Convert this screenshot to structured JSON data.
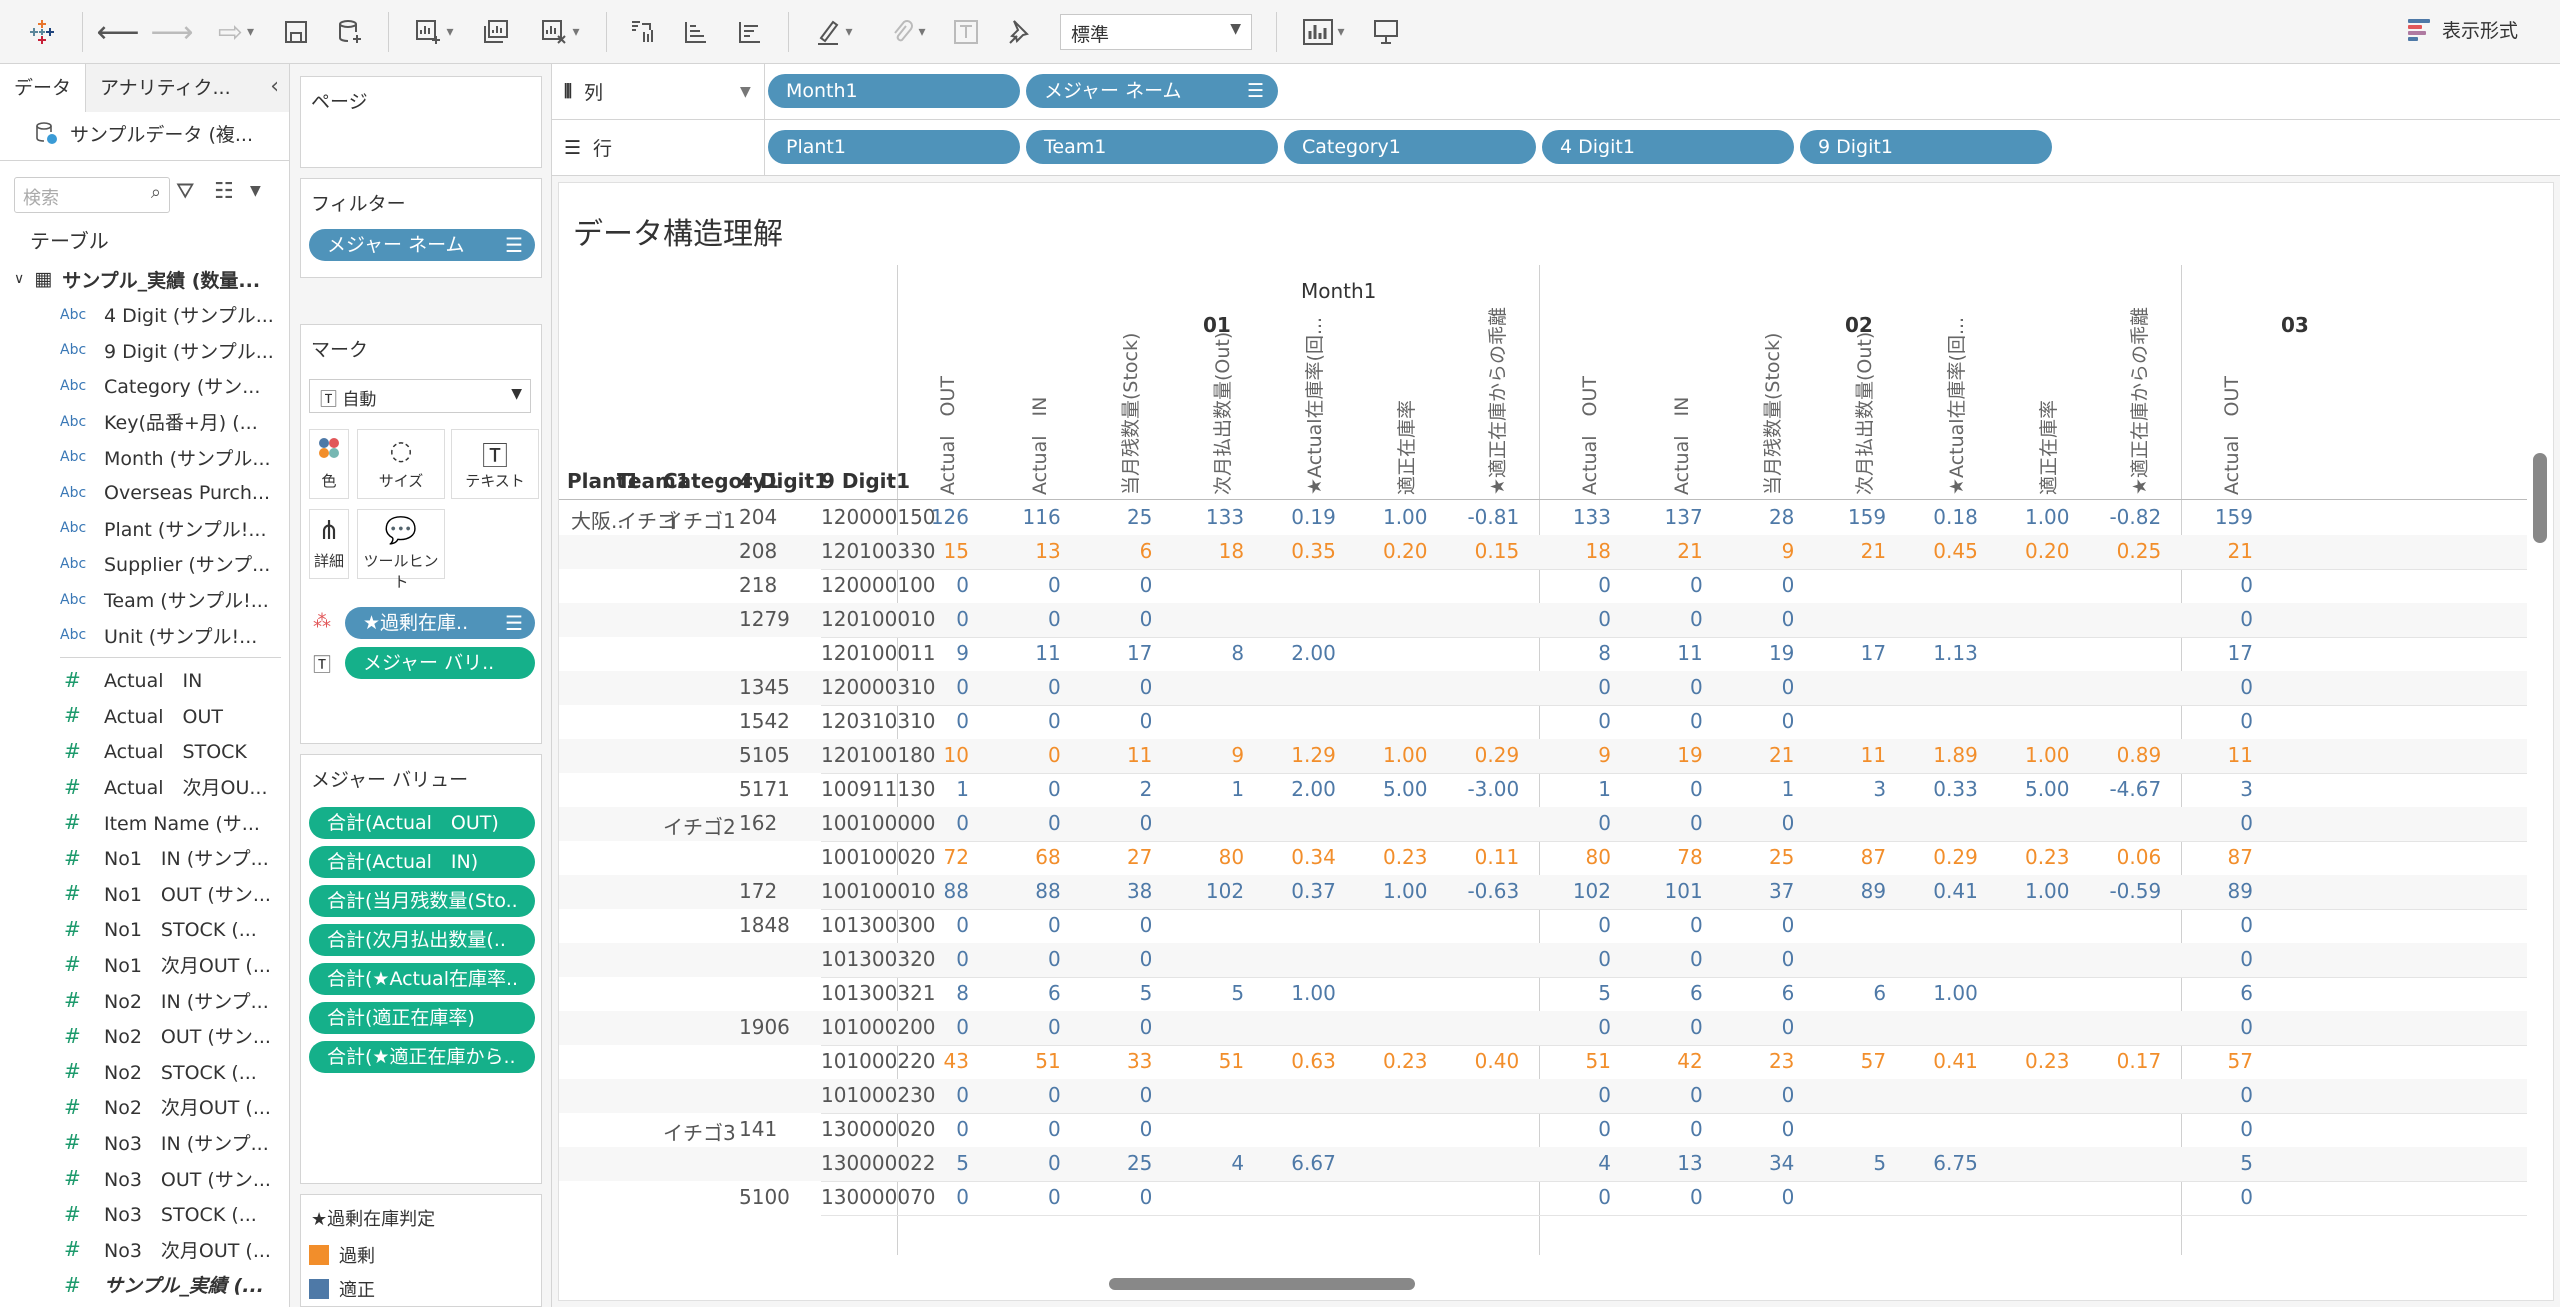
{
  "toolbar": {
    "icons": [
      "tableau-logo-icon",
      "back-icon",
      "forward-icon",
      "redo-icon",
      "save-icon",
      "new-datasource-icon",
      "new-worksheet-icon",
      "duplicate-sheet-icon",
      "clear-sheet-icon",
      "swap-axes-icon",
      "sort-asc-icon",
      "sort-desc-icon",
      "highlight-icon",
      "attach-icon",
      "label-icon",
      "pin-icon",
      "chart-type-icon",
      "presentation-icon"
    ],
    "fit_select": "標準",
    "display_format": "表示形式"
  },
  "data_pane": {
    "tab_data": "データ",
    "tab_analytics": "アナリティク...",
    "datasource": "サンプルデータ (複...",
    "search_placeholder": "検索",
    "tables_header": "テーブル",
    "table_name": "サンプル_実績 (数量...",
    "dimensions": [
      {
        "type": "Abc",
        "name": "4 Digit (サンプル..."
      },
      {
        "type": "Abc",
        "name": "9 Digit (サンプル..."
      },
      {
        "type": "Abc",
        "name": "Category (サン..."
      },
      {
        "type": "Abc",
        "name": "Key(品番+月) (..."
      },
      {
        "type": "Abc",
        "name": "Month (サンプル..."
      },
      {
        "type": "Abc",
        "name": "Overseas Purch..."
      },
      {
        "type": "Abc",
        "name": "Plant (サンプル!..."
      },
      {
        "type": "Abc",
        "name": "Supplier (サンプ..."
      },
      {
        "type": "Abc",
        "name": "Team (サンプル!..."
      },
      {
        "type": "Abc",
        "name": "Unit (サンプル!..."
      }
    ],
    "measures": [
      {
        "type": "#",
        "name": "Actual　IN"
      },
      {
        "type": "#",
        "name": "Actual　OUT"
      },
      {
        "type": "#",
        "name": "Actual　STOCK"
      },
      {
        "type": "#",
        "name": "Actual　次月OU..."
      },
      {
        "type": "#",
        "name": "Item Name (サ..."
      },
      {
        "type": "#",
        "name": "No1　IN (サンプ..."
      },
      {
        "type": "#",
        "name": "No1　OUT (サン..."
      },
      {
        "type": "#",
        "name": "No1　STOCK (..."
      },
      {
        "type": "#",
        "name": "No1　次月OUT (..."
      },
      {
        "type": "#",
        "name": "No2　IN (サンプ..."
      },
      {
        "type": "#",
        "name": "No2　OUT (サン..."
      },
      {
        "type": "#",
        "name": "No2　STOCK (..."
      },
      {
        "type": "#",
        "name": "No2　次月OUT (..."
      },
      {
        "type": "#",
        "name": "No3　IN (サンプ..."
      },
      {
        "type": "#",
        "name": "No3　OUT (サン..."
      },
      {
        "type": "#",
        "name": "No3　STOCK (..."
      },
      {
        "type": "#",
        "name": "No3　次月OUT (..."
      },
      {
        "type": "#",
        "name": "サンプル_実績 (..."
      }
    ]
  },
  "shelves": {
    "pages_title": "ページ",
    "filters_title": "フィルター",
    "filter_pill": "メジャー ネーム",
    "marks_title": "マーク",
    "marks_type": "自動",
    "mark_buttons": {
      "color": "色",
      "size": "サイズ",
      "text": "テキスト",
      "detail": "詳細",
      "tooltip": "ツールヒント"
    },
    "mark_pills": [
      "★過剰在庫..",
      "メジャー バリ.."
    ],
    "measure_values_title": "メジャー バリュー",
    "measure_values": [
      "合計(Actual　OUT)",
      "合計(Actual　IN)",
      "合計(当月残数量(Sto..",
      "合計(次月払出数量(..",
      "合計(★Actual在庫率..",
      "合計(適正在庫率)",
      "合計(★適正在庫から.."
    ],
    "legend_title": "★過剰在庫判定",
    "legend": [
      {
        "label": "過剰",
        "color": "#f28e2b"
      },
      {
        "label": "適正",
        "color": "#4e79a7"
      }
    ],
    "columns_label": "列",
    "rows_label": "行",
    "columns_pills": [
      "Month1",
      "メジャー ネーム"
    ],
    "rows_pills": [
      "Plant1",
      "Team1",
      "Category1",
      "4 Digit1",
      "9 Digit1"
    ]
  },
  "viz": {
    "title": "データ構造理解",
    "month_header": "Month1",
    "months": [
      "01",
      "02",
      "03"
    ],
    "row_headers": [
      "Plant1",
      "Team1",
      "Category1",
      "4 Digit1",
      "9 Digit1"
    ],
    "measure_headers": [
      "Actual　OUT",
      "Actual　IN",
      "当月残数量(Stock)",
      "次月払出数量(Out)",
      "★Actual在庫率(回...",
      "適正在庫率",
      "★適正在庫からの乖離"
    ],
    "colors": {
      "over": "#f28e2b",
      "ok": "#4e79a7"
    },
    "rows": [
      {
        "plant": "大阪..",
        "team": "イチゴ",
        "cat": "イチゴ1",
        "d4": "204",
        "d9": "120000150",
        "c": "ok",
        "m01": [
          "126",
          "116",
          "25",
          "133",
          "0.19",
          "1.00",
          "-0.81"
        ],
        "m02": [
          "133",
          "137",
          "28",
          "159",
          "0.18",
          "1.00",
          "-0.82"
        ],
        "m03": "159"
      },
      {
        "plant": "",
        "team": "",
        "cat": "",
        "d4": "208",
        "d9": "120100330",
        "c": "over",
        "m01": [
          "15",
          "13",
          "6",
          "18",
          "0.35",
          "0.20",
          "0.15"
        ],
        "m02": [
          "18",
          "21",
          "9",
          "21",
          "0.45",
          "0.20",
          "0.25"
        ],
        "m03": "21"
      },
      {
        "plant": "",
        "team": "",
        "cat": "",
        "d4": "218",
        "d9": "120000100",
        "c": "ok",
        "m01": [
          "0",
          "0",
          "0",
          "",
          "",
          "",
          ""
        ],
        "m02": [
          "0",
          "0",
          "0",
          "",
          "",
          "",
          ""
        ],
        "m03": "0"
      },
      {
        "plant": "",
        "team": "",
        "cat": "",
        "d4": "1279",
        "d9": "120100010",
        "c": "ok",
        "m01": [
          "0",
          "0",
          "0",
          "",
          "",
          "",
          ""
        ],
        "m02": [
          "0",
          "0",
          "0",
          "",
          "",
          "",
          ""
        ],
        "m03": "0"
      },
      {
        "plant": "",
        "team": "",
        "cat": "",
        "d4": "",
        "d9": "120100011",
        "c": "ok",
        "m01": [
          "9",
          "11",
          "17",
          "8",
          "2.00",
          "",
          ""
        ],
        "m02": [
          "8",
          "11",
          "19",
          "17",
          "1.13",
          "",
          ""
        ],
        "m03": "17"
      },
      {
        "plant": "",
        "team": "",
        "cat": "",
        "d4": "1345",
        "d9": "120000310",
        "c": "ok",
        "m01": [
          "0",
          "0",
          "0",
          "",
          "",
          "",
          ""
        ],
        "m02": [
          "0",
          "0",
          "0",
          "",
          "",
          "",
          ""
        ],
        "m03": "0"
      },
      {
        "plant": "",
        "team": "",
        "cat": "",
        "d4": "1542",
        "d9": "120310310",
        "c": "ok",
        "m01": [
          "0",
          "0",
          "0",
          "",
          "",
          "",
          ""
        ],
        "m02": [
          "0",
          "0",
          "0",
          "",
          "",
          "",
          ""
        ],
        "m03": "0"
      },
      {
        "plant": "",
        "team": "",
        "cat": "",
        "d4": "5105",
        "d9": "120100180",
        "c": "over",
        "m01": [
          "10",
          "0",
          "11",
          "9",
          "1.29",
          "1.00",
          "0.29"
        ],
        "m02": [
          "9",
          "19",
          "21",
          "11",
          "1.89",
          "1.00",
          "0.89"
        ],
        "m03": "11"
      },
      {
        "plant": "",
        "team": "",
        "cat": "",
        "d4": "5171",
        "d9": "100911130",
        "c": "ok",
        "m01": [
          "1",
          "0",
          "2",
          "1",
          "2.00",
          "5.00",
          "-3.00"
        ],
        "m02": [
          "1",
          "0",
          "1",
          "3",
          "0.33",
          "5.00",
          "-4.67"
        ],
        "m03": "3"
      },
      {
        "plant": "",
        "team": "",
        "cat": "イチゴ2",
        "d4": "162",
        "d9": "100100000",
        "c": "ok",
        "m01": [
          "0",
          "0",
          "0",
          "",
          "",
          "",
          ""
        ],
        "m02": [
          "0",
          "0",
          "0",
          "",
          "",
          "",
          ""
        ],
        "m03": "0"
      },
      {
        "plant": "",
        "team": "",
        "cat": "",
        "d4": "",
        "d9": "100100020",
        "c": "over",
        "m01": [
          "72",
          "68",
          "27",
          "80",
          "0.34",
          "0.23",
          "0.11"
        ],
        "m02": [
          "80",
          "78",
          "25",
          "87",
          "0.29",
          "0.23",
          "0.06"
        ],
        "m03": "87"
      },
      {
        "plant": "",
        "team": "",
        "cat": "",
        "d4": "172",
        "d9": "100100010",
        "c": "ok",
        "m01": [
          "88",
          "88",
          "38",
          "102",
          "0.37",
          "1.00",
          "-0.63"
        ],
        "m02": [
          "102",
          "101",
          "37",
          "89",
          "0.41",
          "1.00",
          "-0.59"
        ],
        "m03": "89"
      },
      {
        "plant": "",
        "team": "",
        "cat": "",
        "d4": "1848",
        "d9": "101300300",
        "c": "ok",
        "m01": [
          "0",
          "0",
          "0",
          "",
          "",
          "",
          ""
        ],
        "m02": [
          "0",
          "0",
          "0",
          "",
          "",
          "",
          ""
        ],
        "m03": "0"
      },
      {
        "plant": "",
        "team": "",
        "cat": "",
        "d4": "",
        "d9": "101300320",
        "c": "ok",
        "m01": [
          "0",
          "0",
          "0",
          "",
          "",
          "",
          ""
        ],
        "m02": [
          "0",
          "0",
          "0",
          "",
          "",
          "",
          ""
        ],
        "m03": "0"
      },
      {
        "plant": "",
        "team": "",
        "cat": "",
        "d4": "",
        "d9": "101300321",
        "c": "ok",
        "m01": [
          "8",
          "6",
          "5",
          "5",
          "1.00",
          "",
          ""
        ],
        "m02": [
          "5",
          "6",
          "6",
          "6",
          "1.00",
          "",
          ""
        ],
        "m03": "6"
      },
      {
        "plant": "",
        "team": "",
        "cat": "",
        "d4": "1906",
        "d9": "101000200",
        "c": "ok",
        "m01": [
          "0",
          "0",
          "0",
          "",
          "",
          "",
          ""
        ],
        "m02": [
          "0",
          "0",
          "0",
          "",
          "",
          "",
          ""
        ],
        "m03": "0"
      },
      {
        "plant": "",
        "team": "",
        "cat": "",
        "d4": "",
        "d9": "101000220",
        "c": "over",
        "m01": [
          "43",
          "51",
          "33",
          "51",
          "0.63",
          "0.23",
          "0.40"
        ],
        "m02": [
          "51",
          "42",
          "23",
          "57",
          "0.41",
          "0.23",
          "0.17"
        ],
        "m03": "57"
      },
      {
        "plant": "",
        "team": "",
        "cat": "",
        "d4": "",
        "d9": "101000230",
        "c": "ok",
        "m01": [
          "0",
          "0",
          "0",
          "",
          "",
          "",
          ""
        ],
        "m02": [
          "0",
          "0",
          "0",
          "",
          "",
          "",
          ""
        ],
        "m03": "0"
      },
      {
        "plant": "",
        "team": "",
        "cat": "イチゴ3",
        "d4": "141",
        "d9": "130000020",
        "c": "ok",
        "m01": [
          "0",
          "0",
          "0",
          "",
          "",
          "",
          ""
        ],
        "m02": [
          "0",
          "0",
          "0",
          "",
          "",
          "",
          ""
        ],
        "m03": "0"
      },
      {
        "plant": "",
        "team": "",
        "cat": "",
        "d4": "",
        "d9": "130000022",
        "c": "ok",
        "m01": [
          "5",
          "0",
          "25",
          "4",
          "6.67",
          "",
          ""
        ],
        "m02": [
          "4",
          "13",
          "34",
          "5",
          "6.75",
          "",
          ""
        ],
        "m03": "5"
      },
      {
        "plant": "",
        "team": "",
        "cat": "",
        "d4": "5100",
        "d9": "130000070",
        "c": "ok",
        "m01": [
          "0",
          "0",
          "0",
          "",
          "",
          "",
          ""
        ],
        "m02": [
          "0",
          "0",
          "0",
          "",
          "",
          "",
          ""
        ],
        "m03": "0"
      }
    ]
  }
}
